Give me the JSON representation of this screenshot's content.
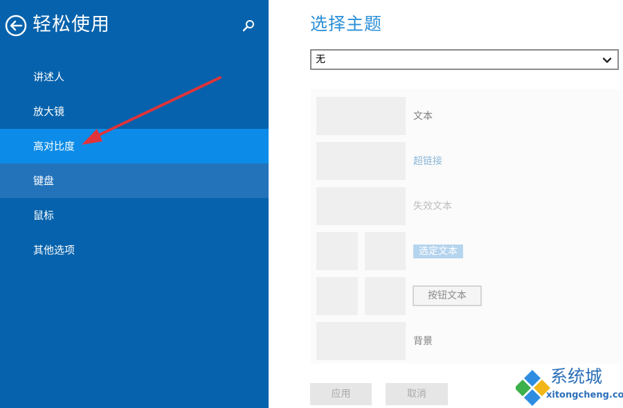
{
  "sidebar": {
    "title": "轻松使用",
    "back_icon": "back-arrow-icon",
    "search_icon": "search-icon",
    "items": [
      {
        "label": "讲述人"
      },
      {
        "label": "放大镜"
      },
      {
        "label": "高对比度"
      },
      {
        "label": "键盘"
      },
      {
        "label": "鼠标"
      },
      {
        "label": "其他选项"
      }
    ],
    "selected_index": 2,
    "hovered_index": 3
  },
  "main": {
    "title": "选择主题",
    "theme_select": {
      "value": "无",
      "icon": "chevron-down-icon"
    },
    "preview": {
      "text": "文本",
      "hyperlink": "超链接",
      "disabled_text": "失效文本",
      "selected_text": "选定文本",
      "button_text": "按钮文本",
      "background": "背景"
    },
    "apply_label": "应用",
    "cancel_label": "取消"
  },
  "watermark": {
    "text": "系统城",
    "url": "xitongcheng.com"
  },
  "colors": {
    "sidebar_bg": "#0662ac",
    "selected_bg": "#0c8ce8",
    "hover_bg": "#2373bb",
    "accent": "#2a8fd8",
    "annotation_arrow": "#e0333a"
  }
}
